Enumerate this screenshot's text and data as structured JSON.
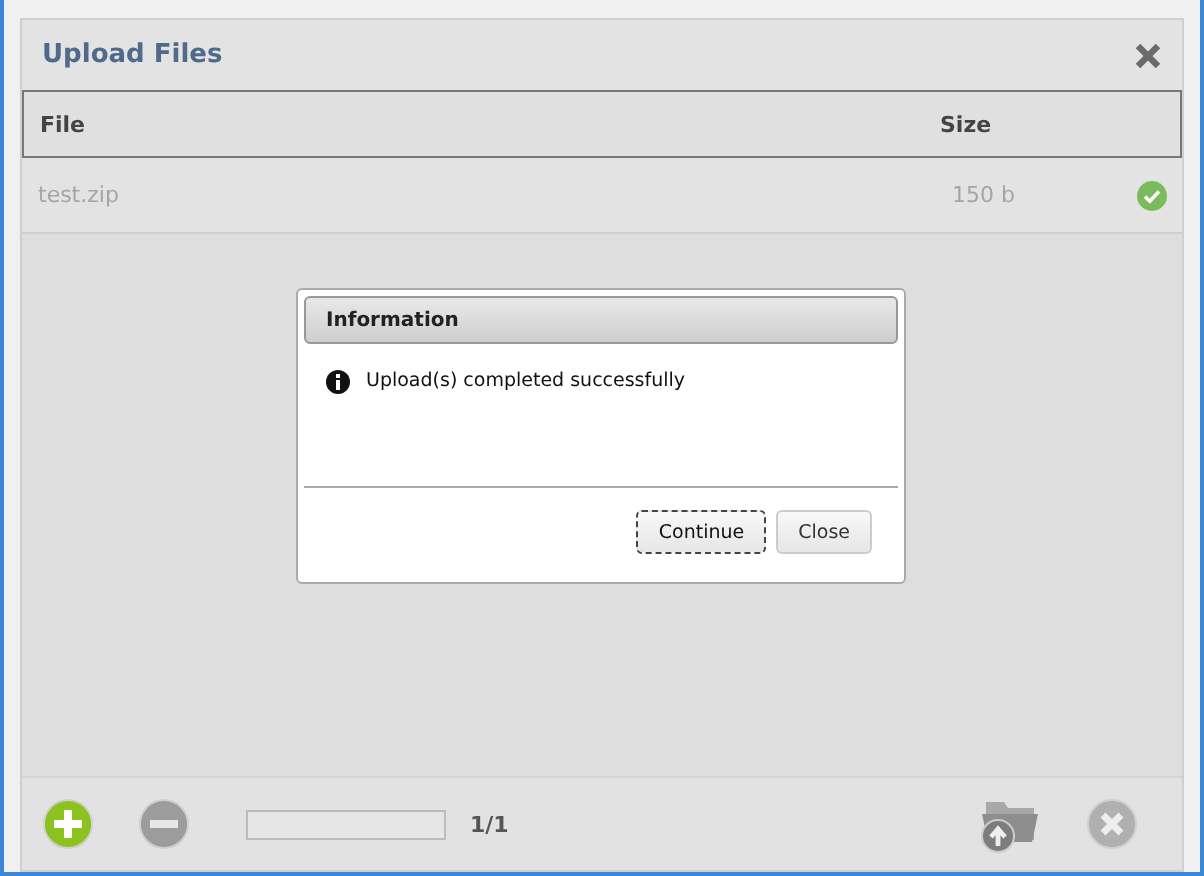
{
  "window": {
    "title": "Upload Files"
  },
  "table": {
    "columns": [
      "File",
      "Size"
    ],
    "rows": [
      {
        "file": "test.zip",
        "size": "150 b",
        "done": true
      }
    ]
  },
  "footer": {
    "progress": {
      "level": 0
    },
    "count": "1/1"
  },
  "dialog": {
    "title": "Information",
    "message": "Upload(s) completed successfully",
    "buttons": [
      {
        "label": "Continue",
        "focused": true
      },
      {
        "label": "Close",
        "focused": false
      }
    ]
  }
}
